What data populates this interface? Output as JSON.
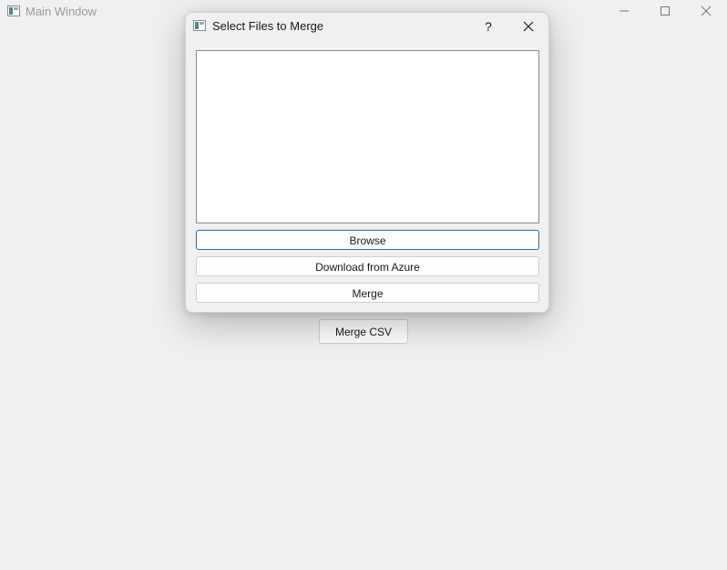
{
  "main_window": {
    "title": "Main Window",
    "icon": "app-window-icon",
    "controls": {
      "minimize": "minimize-icon",
      "maximize": "maximize-icon",
      "close": "close-icon"
    },
    "merge_csv_label": "Merge CSV"
  },
  "dialog": {
    "title": "Select Files to Merge",
    "icon": "app-window-icon",
    "help_label": "?",
    "close_icon": "close-icon",
    "files": [],
    "buttons": {
      "browse": "Browse",
      "download_azure": "Download from Azure",
      "merge": "Merge"
    },
    "accent_color": "#1f6fb5"
  }
}
